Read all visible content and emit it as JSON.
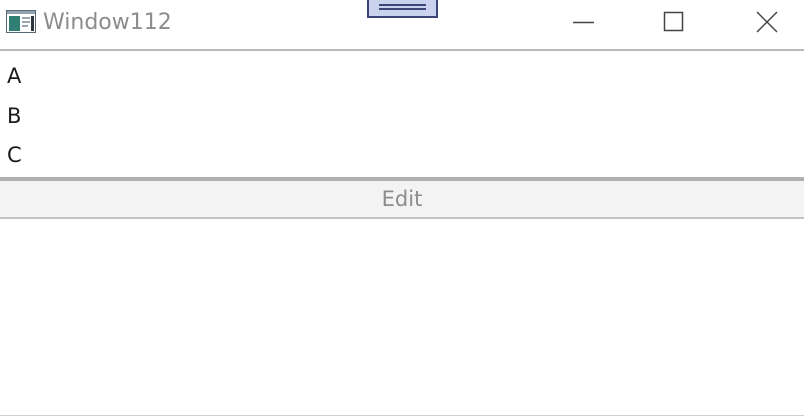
{
  "window": {
    "title": "Window112",
    "icon": "window-app-icon"
  },
  "caption_buttons": {
    "minimize": "minimize-icon",
    "maximize": "maximize-icon",
    "close": "close-icon"
  },
  "list": {
    "items": [
      {
        "label": "A"
      },
      {
        "label": "B"
      },
      {
        "label": "C"
      }
    ]
  },
  "edit_bar": {
    "label": "Edit"
  },
  "colors": {
    "title_text": "#8c8c8c",
    "separator": "#b9b9b9",
    "edit_bar_bg": "#f3f3f3",
    "drag_handle_fill": "#c9d3ee",
    "drag_handle_border": "#3c4778"
  }
}
